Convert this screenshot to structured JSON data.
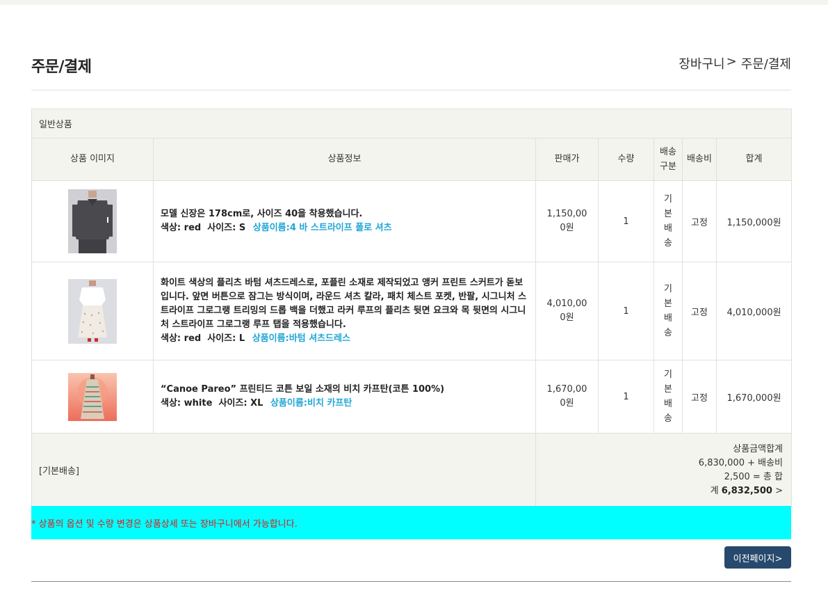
{
  "header": {
    "title": "주문/결제",
    "breadcrumb": [
      "장바구니",
      ">",
      "주문/결제"
    ]
  },
  "group_label": "일반상품",
  "columns": [
    "상품 이미지",
    "상품정보",
    "판매가",
    "수량",
    "배송구분",
    "배송비",
    "합계"
  ],
  "products": [
    {
      "image": "gray-polo-shirt-image",
      "description": "모델 신장은 178cm로, 사이즈 40을 착용했습니다.",
      "color_label": "색상:",
      "color": "red",
      "size_label": "사이즈:",
      "size": "S",
      "product_name": "상품이름:4 바 스트라이프 폴로 셔츠",
      "price": "1,150,000원",
      "quantity": "1",
      "shipping_type": "기본배송",
      "shipping_fee": "고정",
      "total": "1,150,000원"
    },
    {
      "image": "white-shirt-dress-image",
      "description": "화이트 색상의 플리츠 바텀 셔츠드레스로, 포플린 소재로 제작되었고 앵커 프린트 스커트가 돋보입니다. 앞면 버튼으로 잠그는 방식이며, 라운드 셔츠 칼라, 패치 체스트 포켓, 반팔, 시그니처 스트라이프 그로그랭 트리밍의 드롭 백을 더했고 라커 루프의 플리츠 뒷면 요크와 목 뒷면의 시그니처 스트라이프 그로그랭 루프 탭을 적용했습니다.",
      "color_label": "색상:",
      "color": "red",
      "size_label": "사이즈:",
      "size": "L",
      "product_name": "상품이름:바텀 셔츠드레스",
      "price": "4,010,000원",
      "quantity": "1",
      "shipping_type": "기본배송",
      "shipping_fee": "고정",
      "total": "4,010,000원"
    },
    {
      "image": "beach-kaftan-image",
      "description": "“Canoe Pareo” 프린티드 코튼 보일 소재의 비치 카프탄(코튼 100%)",
      "color_label": "색상:",
      "color": "white",
      "size_label": "사이즈:",
      "size": "XL",
      "product_name": "상품이름:비치 카프탄",
      "price": "1,670,000원",
      "quantity": "1",
      "shipping_type": "기본배송",
      "shipping_fee": "고정",
      "total": "1,670,000원"
    }
  ],
  "summary": {
    "shipping_label": "[기본배송]",
    "line1": "상품금액합계",
    "line2": "6,830,000 + 배송비",
    "line3": "2,500 = 총 합",
    "line4_prefix": "계",
    "grand_total": "6,832,500",
    "arrow": ">"
  },
  "notice": "* 상품의 옵션 및 수량 변경은 상품상세 또는 장바구니에서 가능합니다.",
  "prev_button": "이전페이지>",
  "colors": {
    "notice_bg": "#00ffff",
    "notice_text": "#e01a1a",
    "product_name": "#1fa6d6",
    "button_bg": "#27496d",
    "table_head_bg": "#f4f4ef"
  }
}
